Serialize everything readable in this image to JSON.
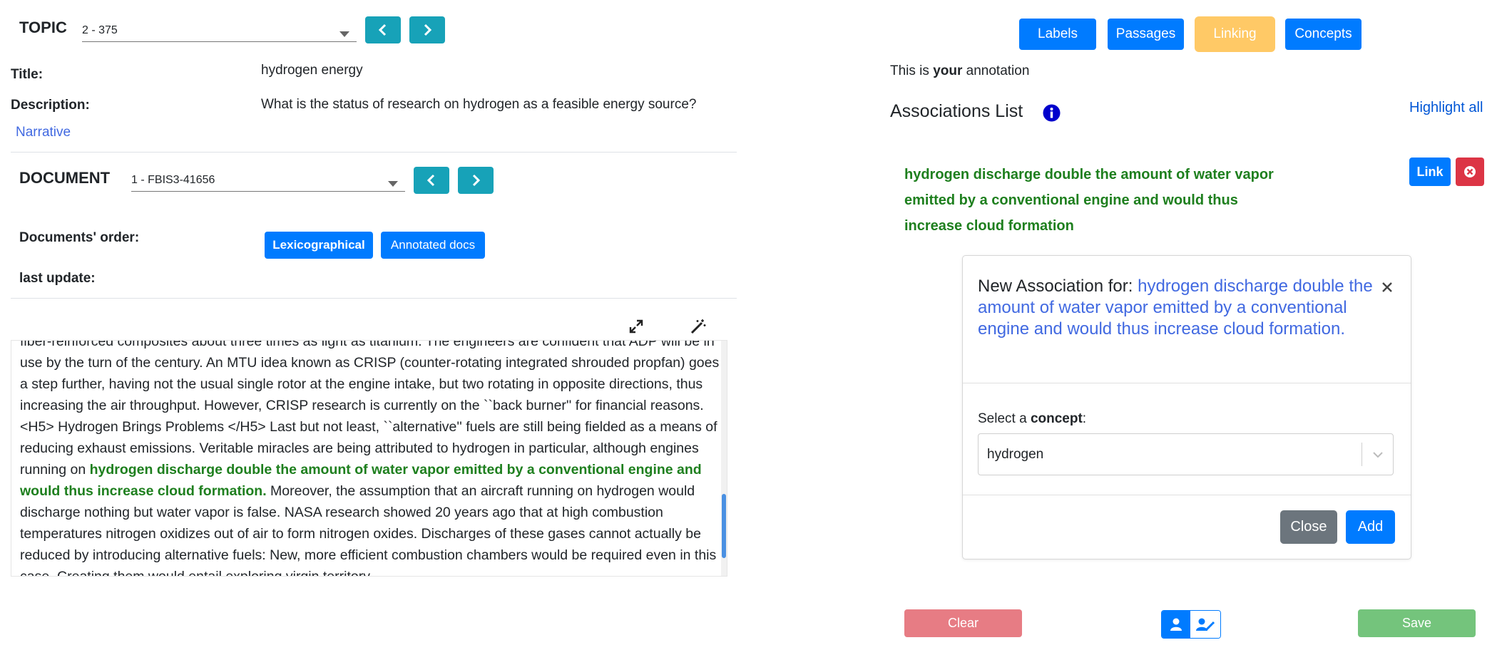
{
  "topic": {
    "label": "TOPIC",
    "selected": "2 - 375"
  },
  "title": {
    "label": "Title:",
    "value": "hydrogen energy"
  },
  "description": {
    "label": "Description:",
    "value": "What is the status of research on hydrogen as a feasible energy source?"
  },
  "narrative_link": "Narrative",
  "document": {
    "label": "DOCUMENT",
    "selected": "1 - FBIS3-41656"
  },
  "docs_order": {
    "label": "Documents' order:",
    "lexicographical": "Lexicographical",
    "annotated": "Annotated docs"
  },
  "last_update": {
    "label": "last update:"
  },
  "doc_text": {
    "p1": "fiber-reinforced composites about three times as light as titanium. The engineers are confident that ADP will be in use by the turn of the century.   An MTU idea known as CRISP (counter-rotating integrated shrouded propfan) goes a step further, having not the usual single rotor at the engine intake, but two rotating in opposite directions, thus increasing the air throughput. However, CRISP research is currently on the ``back burner'' for financial reasons. <H5>  Hydrogen Brings Problems </H5>  Last but not least, ``alternative'' fuels are still being fielded as a means of reducing exhaust emissions. Veritable miracles are being attributed to hydrogen in particular, although engines running on ",
    "highlight": "hydrogen discharge double the amount of water vapor emitted by a conventional engine and would thus increase cloud formation.",
    "p2": " Moreover, the assumption that an aircraft running on hydrogen would discharge nothing but water vapor is false.   NASA research showed 20 years ago that at high combustion temperatures nitrogen oxidizes out of air to form nitrogen oxides. Discharges of these gases cannot actually be reduced by introducing alternative fuels: New, more efficient combustion chambers would be required even in this case. Creating them would entail exploring virgin territory"
  },
  "nav_tabs": {
    "labels": "Labels",
    "passages": "Passages",
    "linking": "Linking",
    "concepts": "Concepts"
  },
  "annotation_note": {
    "prefix": "This is ",
    "bold": "your",
    "suffix": " annotation"
  },
  "associations": {
    "title": "Associations List",
    "highlight_all": "Highlight all",
    "item_text": "hydrogen discharge double the amount of water vapor emitted by a conventional engine and would thus increase cloud formation",
    "link_button": "Link"
  },
  "modal": {
    "title_prefix": "New Association for: ",
    "title_mention": "hydrogen discharge double the amount of water vapor emitted by a conventional engine and would thus increase cloud formation.",
    "select_prefix": "Select a ",
    "select_bold": "concept",
    "select_suffix": ":",
    "select_value": "hydrogen",
    "close_button": "Close",
    "add_button": "Add"
  },
  "footer": {
    "clear": "Clear",
    "save": "Save"
  },
  "colors": {
    "teal": "#17a2b8",
    "primary": "#007bff",
    "warning": "#ffc966",
    "danger": "#dc3545",
    "danger_light": "#e77c84",
    "success_light": "#74c47c",
    "green_text": "#1e7f1e",
    "link_blue": "#4169e1"
  }
}
